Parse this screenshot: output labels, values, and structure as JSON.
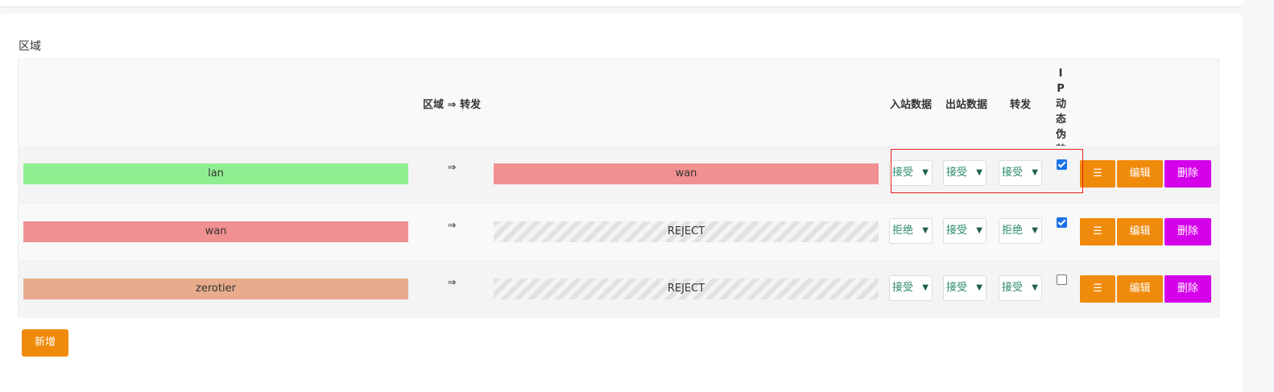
{
  "section": {
    "title": "区域"
  },
  "table": {
    "headers": {
      "zone_forward": "区域 ⇒ 转发",
      "input": "入站数据",
      "output": "出站数据",
      "forward": "转发",
      "masq": "IP动态伪装"
    },
    "arrow_symbol": "⇒",
    "rows": [
      {
        "zone": "lan",
        "zone_color": "#90ee90",
        "dest": "wan",
        "dest_color": "#f09090",
        "dest_striped": false,
        "input": "接受",
        "output": "接受",
        "forward": "接受",
        "masq": true
      },
      {
        "zone": "wan",
        "zone_color": "#f09090",
        "dest": "REJECT",
        "dest_color": "",
        "dest_striped": true,
        "input": "拒绝",
        "output": "接受",
        "forward": "拒绝",
        "masq": true
      },
      {
        "zone": "zerotier",
        "zone_color": "#e8ac8c",
        "dest": "REJECT",
        "dest_color": "",
        "dest_striped": true,
        "input": "接受",
        "output": "接受",
        "forward": "接受",
        "masq": false
      }
    ]
  },
  "actions": {
    "menu_glyph": "☰",
    "edit_label": "编辑",
    "delete_label": "删除"
  },
  "add_label": "新增",
  "colors": {
    "accent_orange": "#f08a0b",
    "delete_purple": "#d400ea",
    "highlight_red": "#e8231e"
  }
}
